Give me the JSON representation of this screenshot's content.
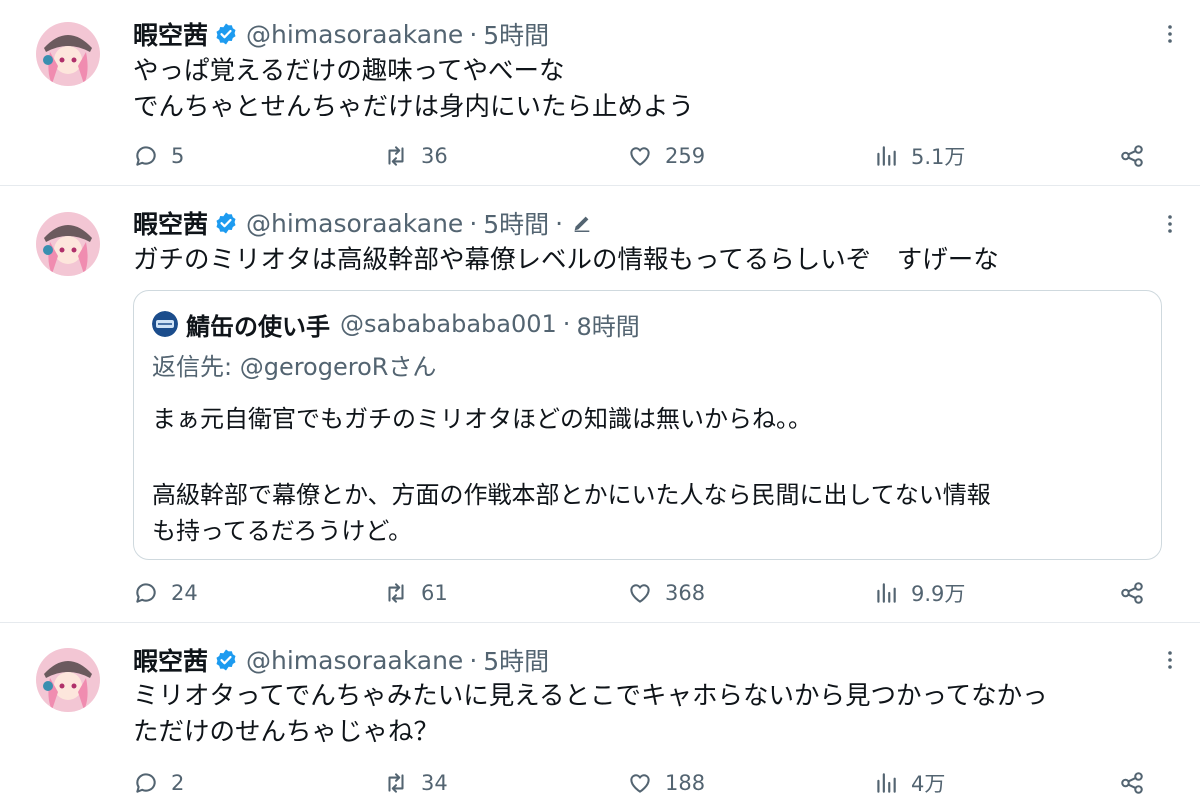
{
  "tweets": [
    {
      "name": "暇空茜",
      "handle": "@himasoraakane",
      "dot": "·",
      "time": "5時間",
      "lines": [
        "やっぱ覚えるだけの趣味ってやべーな",
        "でんちゃとせんちゃだけは身内にいたら止めよう"
      ],
      "replies": "5",
      "reposts": "36",
      "likes": "259",
      "views": "5.1万"
    },
    {
      "name": "暇空茜",
      "handle": "@himasoraakane",
      "dot": "·",
      "time": "5時間",
      "dot2": "·",
      "lines": [
        "ガチのミリオタは高級幹部や幕僚レベルの情報もってるらしいぞ　すげーな"
      ],
      "replies": "24",
      "reposts": "61",
      "likes": "368",
      "views": "9.9万",
      "quote": {
        "name": "鯖缶の使い手",
        "handle": "@sababababa001",
        "dot": "·",
        "time": "8時間",
        "reply_to": "返信先: @gerogeroRさん",
        "lines": [
          "まぁ元自衛官でもガチのミリオタほどの知識は無いからね。。",
          "高級幹部で幕僚とか、方面の作戦本部とかにいた人なら民間に出してない情報",
          "も持ってるだろうけど。"
        ]
      }
    },
    {
      "name": "暇空茜",
      "handle": "@himasoraakane",
      "dot": "·",
      "time": "5時間",
      "lines": [
        "ミリオタってでんちゃみたいに見えるとこでキャホらないから見つかってなかっ",
        "ただけのせんちゃじゃね？"
      ],
      "replies": "2",
      "reposts": "34",
      "likes": "188",
      "views": "4万"
    }
  ],
  "colors": {
    "accent": "#1d9bf0",
    "muted": "#536471",
    "text": "#0f1419",
    "border": "#cfd9de"
  },
  "icons": [
    "verified-badge-icon",
    "more-icon",
    "reply-icon",
    "repost-icon",
    "like-icon",
    "views-icon",
    "share-icon",
    "edit-icon"
  ]
}
